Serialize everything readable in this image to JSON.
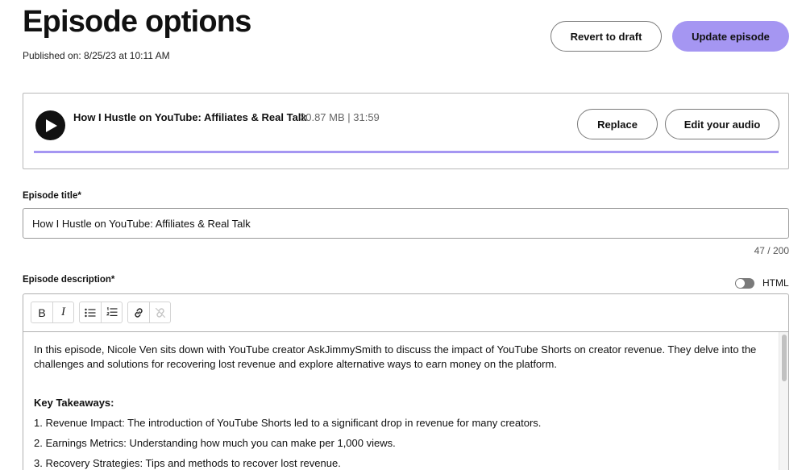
{
  "header": {
    "title": "Episode options",
    "published": "Published on: 8/25/23 at 10:11 AM",
    "revert_label": "Revert to draft",
    "update_label": "Update episode"
  },
  "audio": {
    "title": "How I Hustle on YouTube: Affiliates & Real Talk",
    "meta": "30.87 MB | 31:59",
    "replace_label": "Replace",
    "edit_label": "Edit your audio",
    "upload_progress": 1.0,
    "play_icon": "play-icon",
    "accent_color": "#a596f2"
  },
  "episode_title": {
    "label": "Episode title*",
    "value": "How I Hustle on YouTube: Affiliates & Real Talk",
    "count": "47 / 200"
  },
  "episode_description": {
    "label": "Episode description*",
    "html_toggle_label": "HTML",
    "html_toggle_on": false,
    "toolbar": {
      "bold": "B",
      "italic": "I",
      "icons": [
        "bullet-list-icon",
        "numbered-list-icon",
        "link-icon",
        "unlink-icon"
      ]
    },
    "intro": "In this episode, Nicole Ven sits down with YouTube creator AskJimmySmith to discuss the impact of YouTube Shorts on creator revenue. They delve into the challenges and solutions for recovering lost revenue and explore alternative ways to earn money on the platform.",
    "key_heading": "Key Takeaways:",
    "takeaways": [
      "1. Revenue Impact: The introduction of YouTube Shorts led to a significant drop in revenue for many creators.",
      "2. Earnings Metrics: Understanding how much you can make per 1,000 views.",
      "3. Recovery Strategies: Tips and methods to recover lost revenue."
    ]
  }
}
